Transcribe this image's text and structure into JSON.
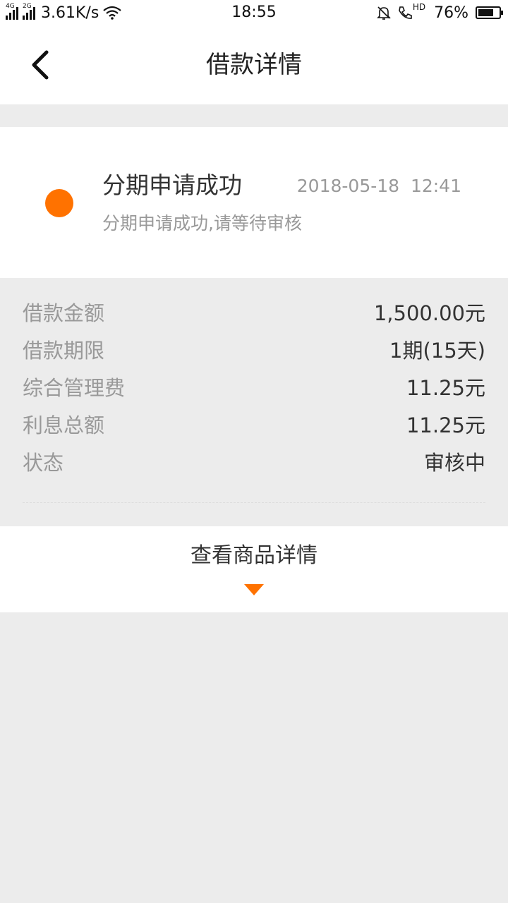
{
  "status_bar": {
    "sim1_tag": "4G",
    "sim2_tag": "2G",
    "net_speed": "3.61K/s",
    "time": "18:55",
    "hd_tag": "HD",
    "battery": "76%",
    "battery_level": 0.76
  },
  "nav": {
    "title": "借款详情",
    "back_icon": "chevron-left-icon"
  },
  "status_card": {
    "title": "分期申请成功",
    "time": "2018-05-18  12:41",
    "subtitle": "分期申请成功,请等待审核",
    "dot_color": "#ff7200"
  },
  "details": [
    {
      "label": "借款金额",
      "value": "1,500.00元"
    },
    {
      "label": "借款期限",
      "value": "1期(15天)"
    },
    {
      "label": "综合管理费",
      "value": "11.25元"
    },
    {
      "label": "利息总额",
      "value": "11.25元"
    },
    {
      "label": "状态",
      "value": "审核中"
    }
  ],
  "product": {
    "label": "查看商品详情",
    "arrow_icon": "triangle-down-icon",
    "accent": "#ff7200"
  }
}
